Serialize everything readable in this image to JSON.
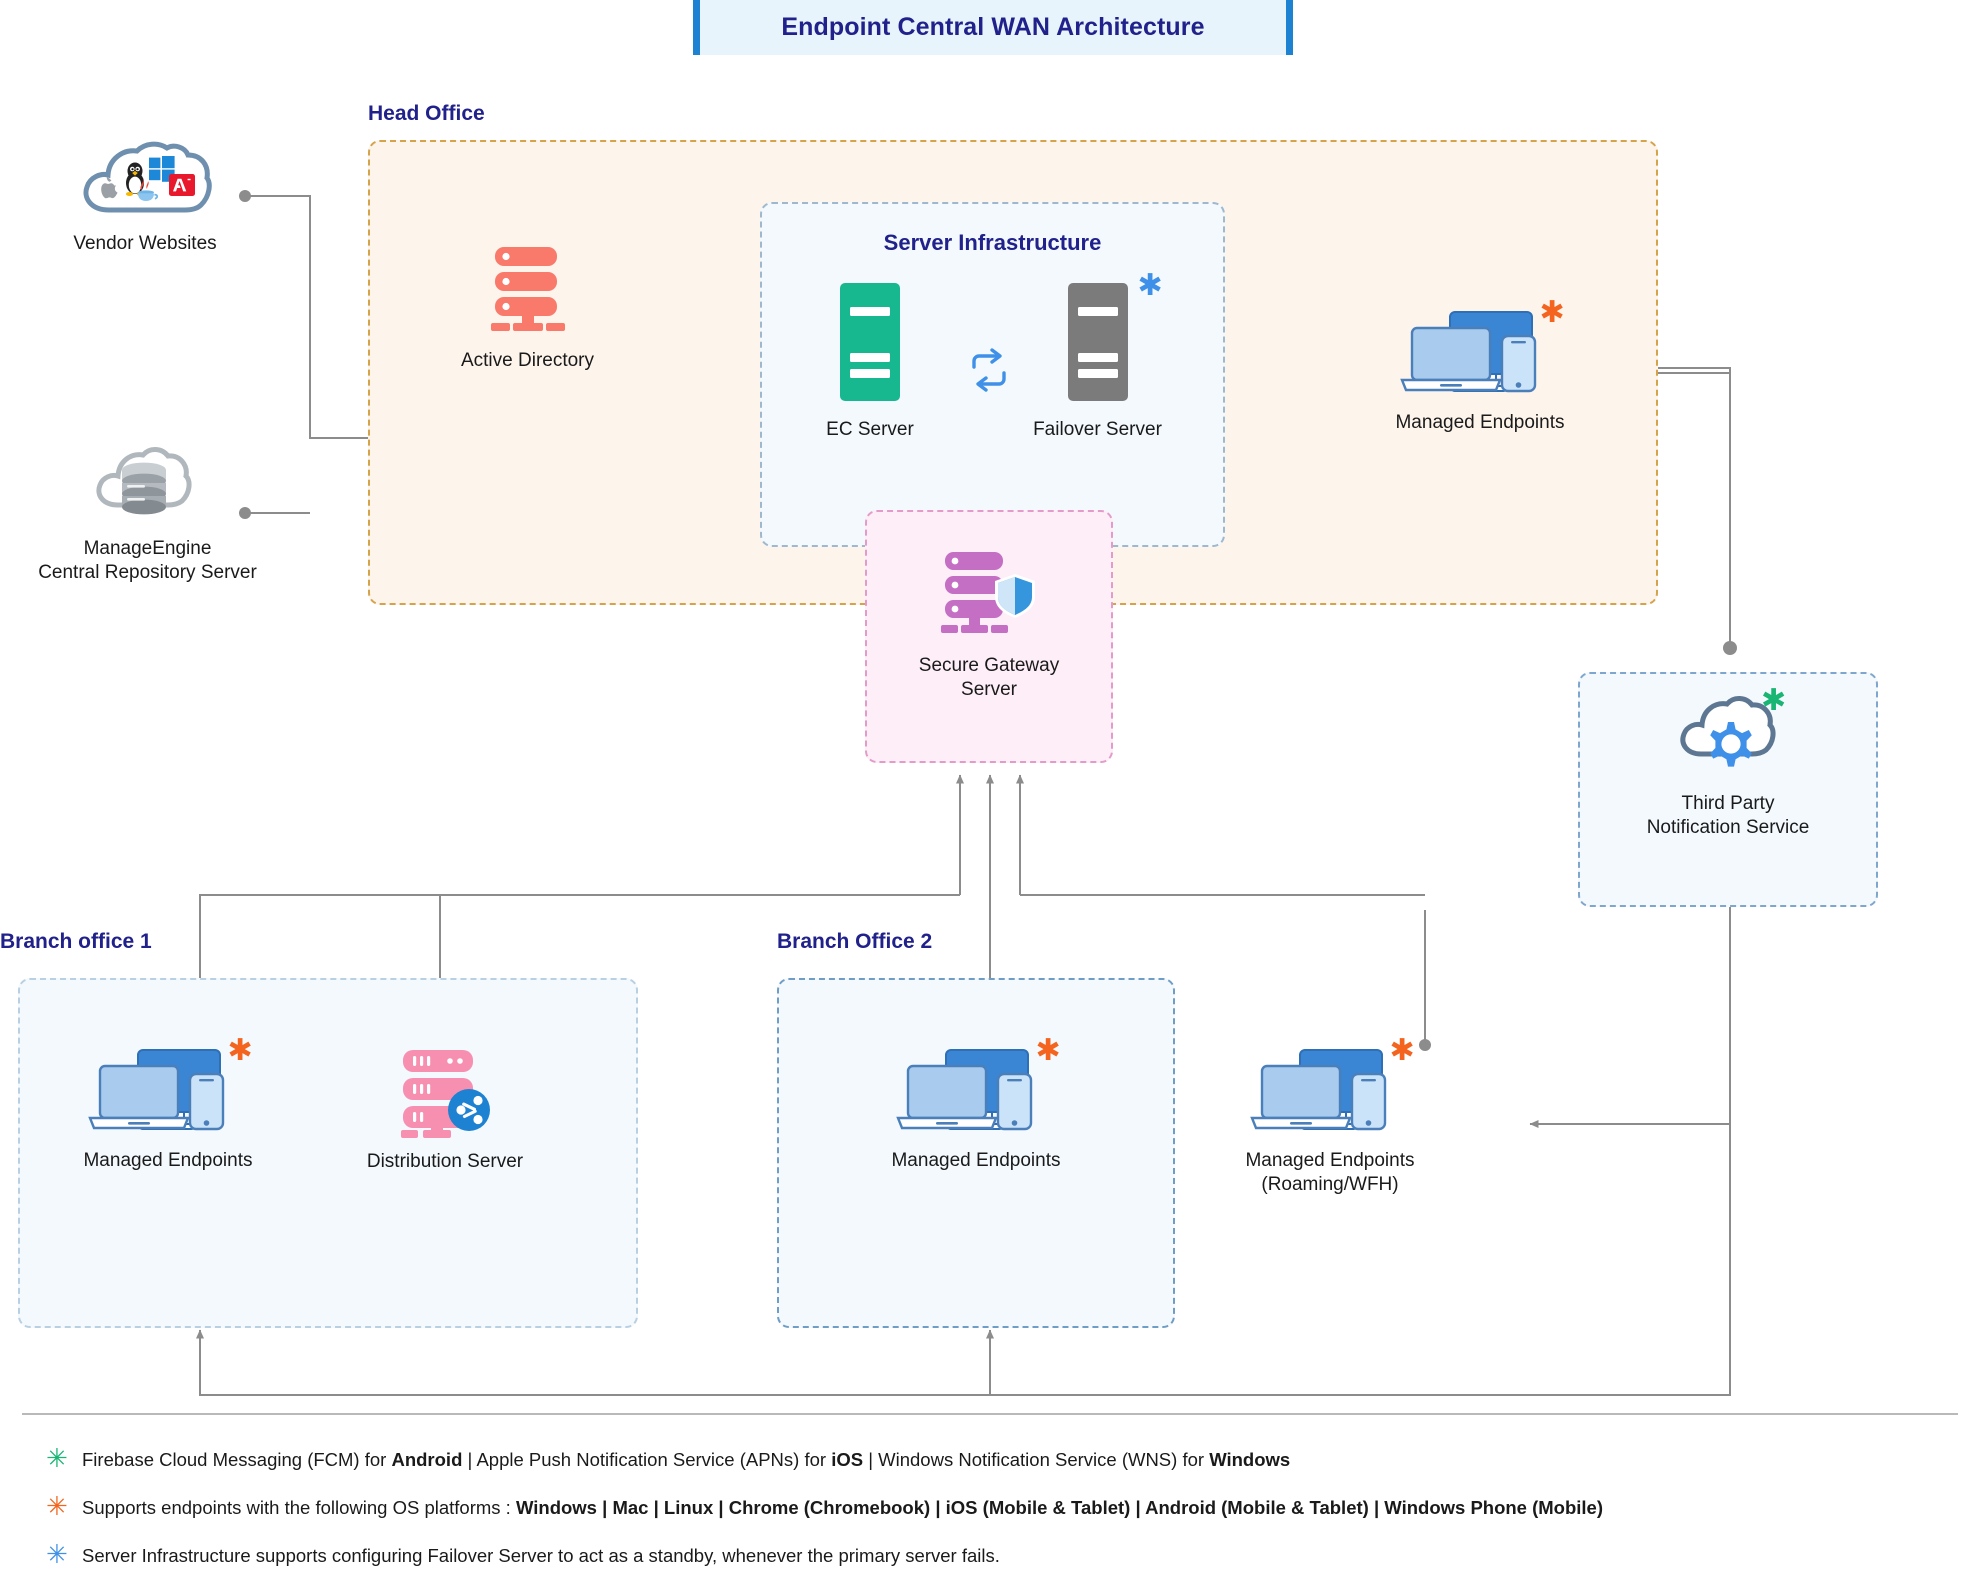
{
  "header": {
    "title": "Endpoint Central WAN Architecture",
    "accent": "#1e82d2",
    "bg": "#e8f4fc",
    "text_color": "#21218c"
  },
  "zones": {
    "head_office": {
      "label": "Head Office",
      "border": "#d5a34a",
      "fill": "#fdf4ec"
    },
    "server_infrastructure": {
      "label": "Server Infrastructure",
      "border": "#9fb8cd",
      "fill": "#f3f9fd"
    },
    "secure_gateway": {
      "border": "#e39cc9",
      "fill": "#fdeef8"
    },
    "third_party": {
      "border": "#7fa6cc",
      "fill": "#f3f9fd"
    },
    "branch_office_1": {
      "label": "Branch office 1",
      "border": "#b9cfe2",
      "fill": "#f3f9fd"
    },
    "branch_office_2": {
      "label": "Branch Office 2",
      "border": "#6f9dc6",
      "fill": "#f3f9fd"
    }
  },
  "nodes": {
    "vendor_websites": {
      "label": "Vendor Websites",
      "icon": "cloud-vendor-logos-icon",
      "logos": [
        "apple",
        "linux-tux",
        "windows",
        "java",
        "adobe"
      ],
      "cloud_color": "#6f8fae"
    },
    "central_repository": {
      "label": "ManageEngine\nCentral Repository Server",
      "icon": "cloud-database-icon",
      "color": "#b0b8bd"
    },
    "active_directory": {
      "label": "Active Directory",
      "icon": "server-rack-icon",
      "color": "#f9796b"
    },
    "ec_server": {
      "label": "EC Server",
      "icon": "server-tower-icon",
      "color": "#17b890"
    },
    "failover_server": {
      "label": "Failover Server",
      "icon": "server-tower-icon",
      "color": "#7b7b7b",
      "marker": "blue"
    },
    "sync": {
      "icon": "sync-repeat-icon",
      "color": "#3f90e8"
    },
    "secure_gateway_server": {
      "label": "Secure Gateway\nServer",
      "icon": "server-rack-shield-icon",
      "color": "#c46ec4",
      "shield_color": "#3596dd"
    },
    "managed_endpoints_head": {
      "label": "Managed Endpoints",
      "icon": "devices-cluster-icon",
      "marker": "orange"
    },
    "third_party_notification": {
      "label": "Third Party\nNotification Service",
      "icon": "cloud-gear-icon",
      "cloud_color": "#5d7793",
      "gear_color": "#3f90e8",
      "marker": "green"
    },
    "managed_endpoints_b1": {
      "label": "Managed Endpoints",
      "icon": "devices-cluster-icon",
      "marker": "orange"
    },
    "distribution_server": {
      "label": "Distribution Server",
      "icon": "server-rack-share-icon",
      "color": "#f78fb0",
      "share_color": "#1e82d2"
    },
    "managed_endpoints_b2": {
      "label": "Managed Endpoints",
      "icon": "devices-cluster-icon",
      "marker": "orange"
    },
    "managed_endpoints_roaming": {
      "label": "Managed Endpoints\n(Roaming/WFH)",
      "icon": "devices-cluster-icon",
      "marker": "orange"
    }
  },
  "legend": [
    {
      "marker": "*",
      "marker_color": "#18b573",
      "marker_name": "green-asterisk-icon",
      "segments": [
        {
          "text": "Firebase Cloud Messaging (FCM) for ",
          "bold": false
        },
        {
          "text": "Android",
          "bold": true
        },
        {
          "text": "   |   ",
          "bold": false
        },
        {
          "text": "Apple Push Notification Service (APNs) for ",
          "bold": false
        },
        {
          "text": "iOS",
          "bold": true
        },
        {
          "text": "   |   ",
          "bold": false
        },
        {
          "text": "Windows Notification Service (WNS) for ",
          "bold": false
        },
        {
          "text": "Windows",
          "bold": true
        }
      ]
    },
    {
      "marker": "*",
      "marker_color": "#f4641e",
      "marker_name": "orange-asterisk-icon",
      "segments": [
        {
          "text": "Supports endpoints with the following OS platforms :  ",
          "bold": false
        },
        {
          "text": "Windows",
          "bold": true
        },
        {
          "text": "  |  ",
          "bold": true
        },
        {
          "text": "Mac",
          "bold": true
        },
        {
          "text": "  |  ",
          "bold": true
        },
        {
          "text": "Linux",
          "bold": true
        },
        {
          "text": "  |  ",
          "bold": true
        },
        {
          "text": "Chrome (Chromebook)",
          "bold": true
        },
        {
          "text": "  |  ",
          "bold": true
        },
        {
          "text": "iOS (Mobile & Tablet)",
          "bold": true
        },
        {
          "text": "  |  ",
          "bold": true
        },
        {
          "text": "Android (Mobile & Tablet)",
          "bold": true
        },
        {
          "text": "  |  ",
          "bold": true
        },
        {
          "text": "Windows Phone (Mobile)",
          "bold": true
        }
      ]
    },
    {
      "marker": "*",
      "marker_color": "#3f90e8",
      "marker_name": "blue-asterisk-icon",
      "segments": [
        {
          "text": "Server Infrastructure supports configuring Failover Server to act as a standby, whenever the primary server fails.",
          "bold": false
        }
      ]
    }
  ]
}
